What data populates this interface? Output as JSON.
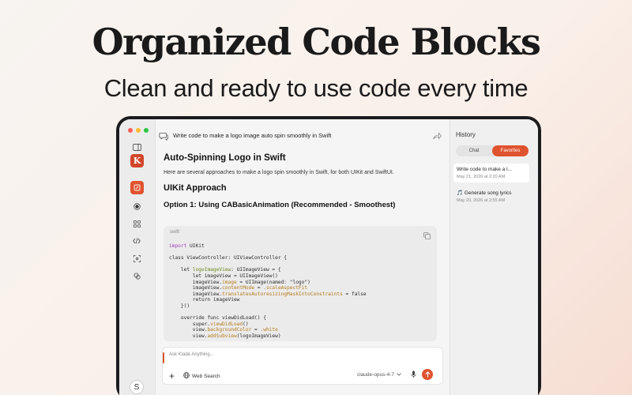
{
  "hero": {
    "title": "Organized Code Blocks",
    "subtitle": "Clean and ready to use code every time"
  },
  "colors": {
    "accent": "#e0532f",
    "logo": "#d2462a",
    "traffic": [
      "#fe5f57",
      "#febc2e",
      "#28c840"
    ]
  },
  "rail": {
    "logo_letter": "K",
    "avatar_letter": "S",
    "icons": [
      "sidebar-toggle-icon",
      "new-chat-icon",
      "record-icon",
      "grid-icon",
      "code-icon",
      "scan-icon",
      "chat-bubbles-icon"
    ]
  },
  "topbar": {
    "title": "Write code to make a logo image auto spin smoothly in Swift"
  },
  "message": {
    "h1": "Auto-Spinning Logo in Swift",
    "intro": "Here are several approaches to make a logo spin smoothly in Swift, for both UIKit and SwiftUI.",
    "h2": "UIKit Approach",
    "h3": "Option 1: Using CABasicAnimation (Recommended - Smoothest)"
  },
  "code": {
    "language": "swift",
    "lines": {
      "l1a": "import",
      "l1b": " UIKit",
      "l2": "class ViewController: UIViewController {",
      "l3a": "    let ",
      "l3b": "logoImageView",
      "l3c": ": UIImageView = {",
      "l4": "        let imageView = UIImageView()",
      "l5a": "        imageView.",
      "l5b": "image",
      "l5c": " = UIImage(named: \"logo\")",
      "l6a": "        imageView.",
      "l6b": "contentMode",
      "l6c": " = ",
      "l6d": ".scaleAspectFit",
      "l7a": "        imageView.",
      "l7b": "translatesAutoresizingMaskIntoConstraints",
      "l7c": " = false",
      "l8": "        return imageView",
      "l9": "    }()",
      "l10": "    override func viewDidLoad() {",
      "l11a": "        super.",
      "l11b": "viewDidLoad",
      "l11c": "()",
      "l12a": "        view.",
      "l12b": "backgroundColor",
      "l12c": " = ",
      "l12d": ".white",
      "l13a": "        view.",
      "l13b": "addSubview",
      "l13c": "(logoImageView)"
    }
  },
  "composer": {
    "placeholder": "Ask Klade Anything...",
    "web_search": "Web Search",
    "model": "claude-opus-4-7"
  },
  "history": {
    "title": "History",
    "tabs": [
      "Chat",
      "Favorites"
    ],
    "active_tab": "Favorites",
    "items": [
      {
        "name": "Write code to make a l...",
        "date": "May 21, 2026 at 2:20 AM",
        "icon": ""
      },
      {
        "name": "Generate song lyrics",
        "date": "May 20, 2026 at 2:55 AM",
        "icon": "🎵"
      }
    ]
  }
}
